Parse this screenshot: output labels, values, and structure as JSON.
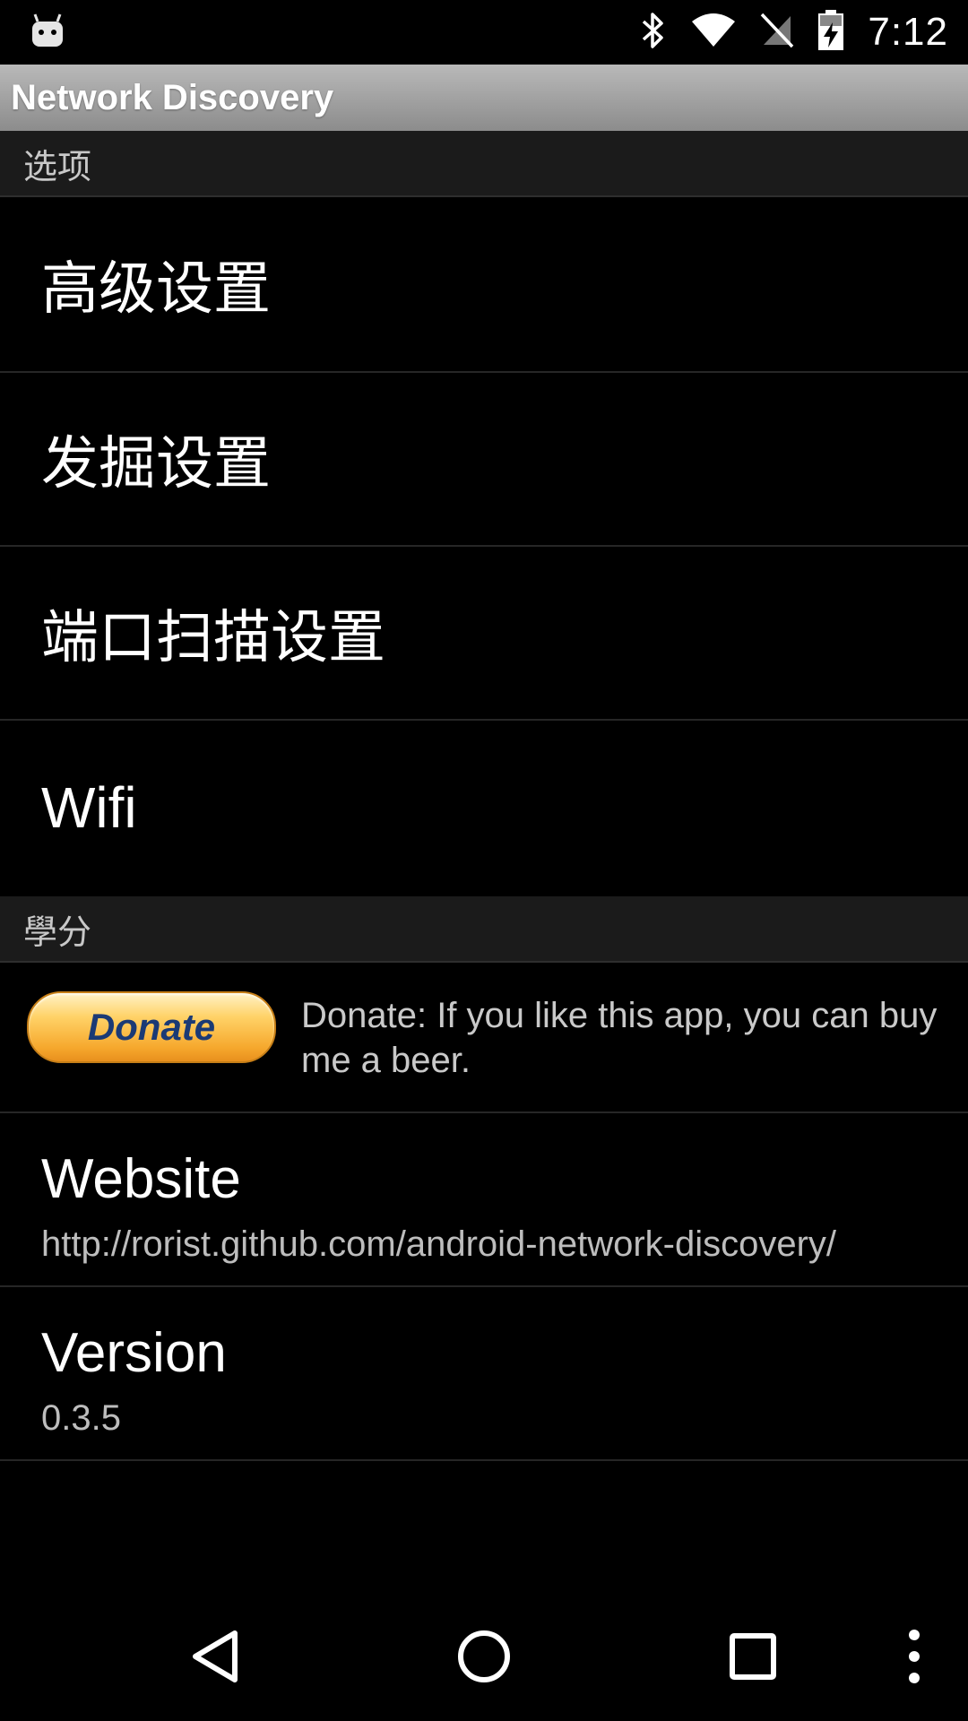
{
  "status_bar": {
    "time": "7:12",
    "icons": [
      "android-robot-icon",
      "bluetooth-icon",
      "wifi-icon",
      "no-sim-icon",
      "battery-charging-icon"
    ]
  },
  "action_bar": {
    "title": "Network Discovery"
  },
  "sections": {
    "options": {
      "title": "选项",
      "items": [
        {
          "label": "高级设置"
        },
        {
          "label": "发掘设置"
        },
        {
          "label": "端口扫描设置"
        },
        {
          "label": "Wifi"
        }
      ]
    },
    "credits": {
      "title": "學分",
      "donate": {
        "button_label": "Donate",
        "description": "Donate: If you like this app, you can buy me a beer."
      },
      "website": {
        "title": "Website",
        "summary": "http://rorist.github.com/android-network-discovery/"
      },
      "version": {
        "title": "Version",
        "summary": "0.3.5"
      }
    }
  },
  "nav_bar": {
    "icons": [
      "back-icon",
      "home-icon",
      "recents-icon",
      "overflow-menu-icon"
    ]
  },
  "colors": {
    "background": "#000000",
    "section_header": "#1b1b1b",
    "action_bar": "#a0a0a0",
    "donate_button": "#f8b73a"
  }
}
